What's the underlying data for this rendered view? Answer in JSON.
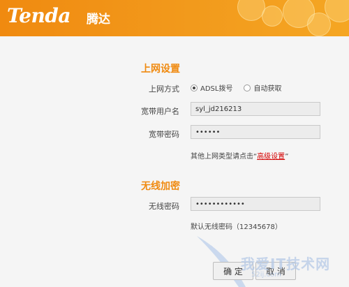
{
  "header": {
    "brand_logo": "Tenda",
    "brand_cn": "腾达",
    "accent": "#f08a10"
  },
  "internet": {
    "title": "上网设置",
    "mode_label": "上网方式",
    "mode_options": [
      "ADSL拨号",
      "自动获取"
    ],
    "mode_selected": "ADSL拨号",
    "username_label": "宽带用户名",
    "username_value": "syl_jd216213",
    "password_label": "宽带密码",
    "password_value": "••••••",
    "hint_prefix": "其他上网类型请点击“",
    "hint_link": "高级设置",
    "hint_suffix": "”"
  },
  "wireless": {
    "title": "无线加密",
    "password_label": "无线密码",
    "password_value": "••••••••••••",
    "default_hint": "默认无线密码（12345678）"
  },
  "buttons": {
    "confirm": "确 定",
    "cancel": "取 消"
  },
  "watermark": {
    "text": "我爱IT技术网",
    "sub": "52ij.com"
  }
}
